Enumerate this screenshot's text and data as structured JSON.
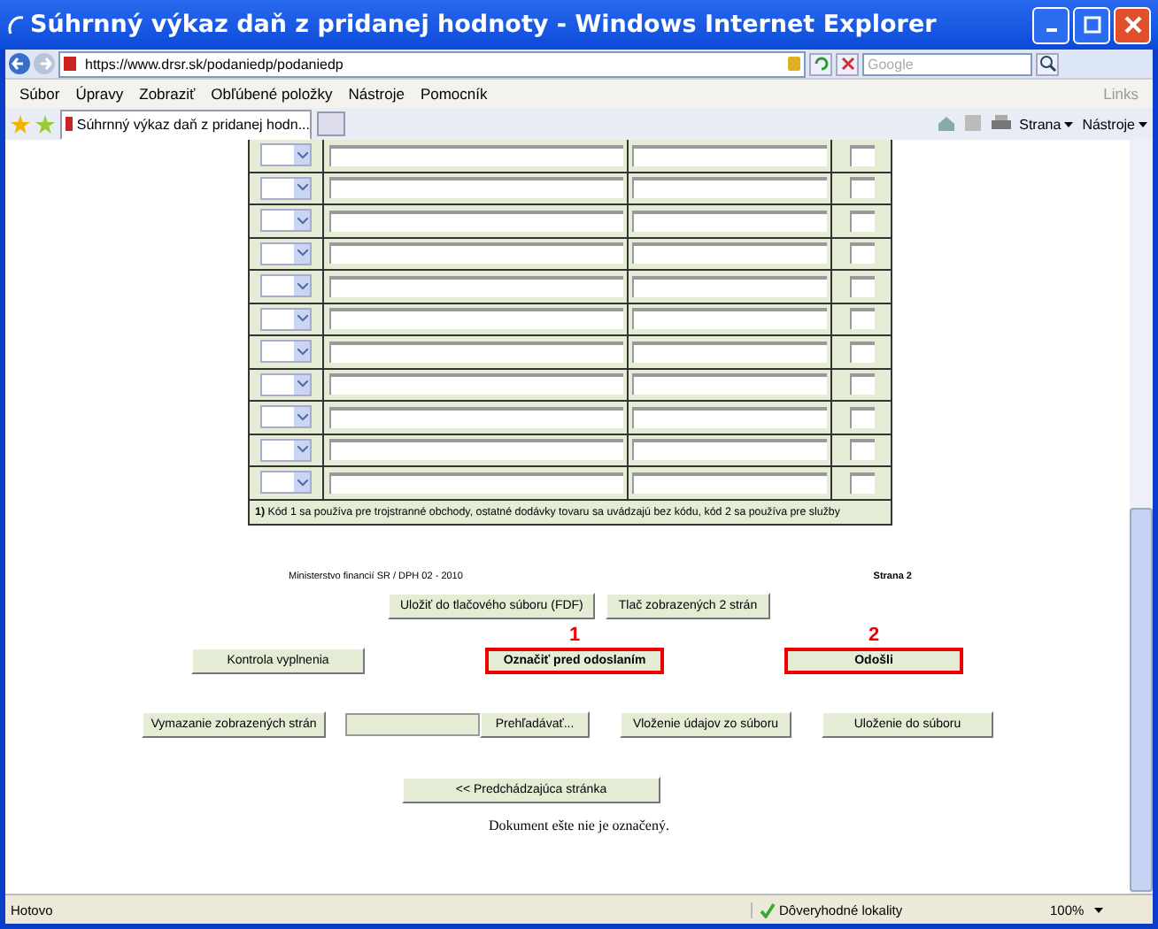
{
  "window": {
    "title": "Súhrnný výkaz daň z pridanej hodnoty - Windows Internet Explorer"
  },
  "address_bar": {
    "url": "https://www.drsr.sk/podaniedp/podaniedp",
    "search_placeholder": "Google"
  },
  "menu": [
    "Súbor",
    "Úpravy",
    "Zobraziť",
    "Obľúbené položky",
    "Nástroje",
    "Pomocník"
  ],
  "links_label": "Links",
  "tab": {
    "title": "Súhrnný výkaz daň z pridanej hodn...",
    "selected": true
  },
  "command_bar": [
    "Strana",
    "Nástroje"
  ],
  "table": {
    "rows": [
      {
        "kind": "entry"
      },
      {
        "kind": "entry"
      },
      {
        "kind": "entry"
      },
      {
        "kind": "entry"
      },
      {
        "kind": "entry"
      },
      {
        "kind": "entry"
      },
      {
        "kind": "entry"
      },
      {
        "kind": "entry"
      },
      {
        "kind": "entry"
      },
      {
        "kind": "entry"
      },
      {
        "kind": "entry"
      }
    ],
    "footnote": "**1)** Kód 1 sa používa pre trojstranné obchody, ostatné dodávky tovaru sa uvádzajú bez kódu, kód 2 sa používa pre služby"
  },
  "form_footer": {
    "left": "Ministerstvo financií SR / DPH 02 - 2010",
    "right": "Strana 2"
  },
  "print_buttons": [
    "Uložiť do tlačového súboru  (FDF)",
    "Tlač zobrazených 2 strán"
  ],
  "action_buttons": [
    {
      "label": "Kontrola vyplnenia",
      "highlighted": false
    },
    {
      "label": "Označiť pred odoslaním",
      "highlighted": true,
      "annotation": "1"
    },
    {
      "label": "Odošli",
      "highlighted": true,
      "annotation": "2"
    }
  ],
  "file_row": {
    "clear_button": "Vymazanie zobrazených strán",
    "browse_button": "Prehľadávať...",
    "load_button": "Vloženie údajov zo súboru",
    "save_button": "Uloženie do súboru"
  },
  "prev_button": "<< Predchádzajúca stránka",
  "document_status": "Dokument ešte nie je označený.",
  "status_bar": {
    "text": "Hotovo",
    "zone": "Dôveryhodné lokality",
    "zoom": "100%"
  }
}
